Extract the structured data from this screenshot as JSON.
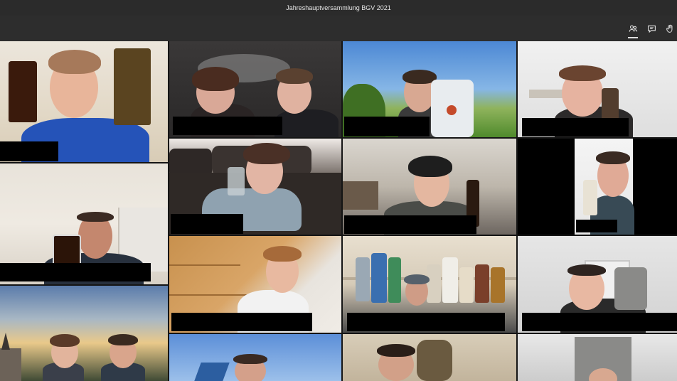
{
  "window": {
    "title": "Jahreshauptversammlung BGV 2021"
  },
  "toolbar": {
    "icons": [
      "participants-icon",
      "chat-icon",
      "raise-hand-icon"
    ],
    "active": "participants-icon"
  },
  "colors": {
    "titlebar": "#2b2b2b",
    "toolbar": "#2d2d2d",
    "name_bar": "#000000",
    "grid_gap": "#151515"
  },
  "gallery": {
    "columns": 4,
    "visible_rows": 5,
    "tile_count": 18,
    "name_labels": "redacted"
  }
}
